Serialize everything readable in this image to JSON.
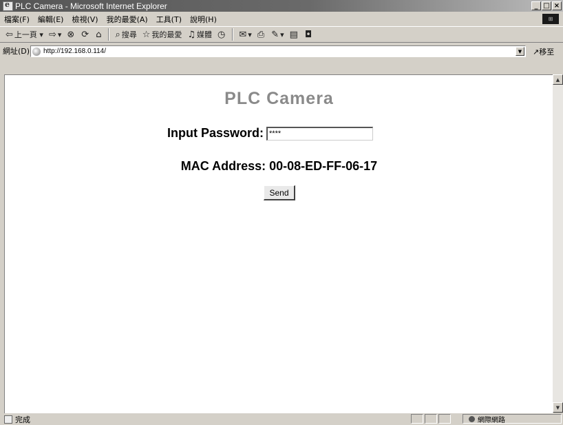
{
  "window": {
    "title": "PLC Camera - Microsoft Internet Explorer"
  },
  "menu": [
    "檔案(F)",
    "編輯(E)",
    "檢視(V)",
    "我的最愛(A)",
    "工具(T)",
    "說明(H)"
  ],
  "toolbar": {
    "back": "上一頁",
    "search": "搜尋",
    "favorites": "我的最愛",
    "media": "媒體"
  },
  "address": {
    "label": "網址(D)",
    "url": "http://192.168.0.114/",
    "go": "移至"
  },
  "page": {
    "heading": "PLC Camera",
    "password_label": "Input Password:",
    "password_value": "****",
    "mac_text": "MAC Address: 00-08-ED-FF-06-17",
    "send_label": "Send"
  },
  "status": {
    "text": "完成",
    "zone": "網際網路"
  }
}
